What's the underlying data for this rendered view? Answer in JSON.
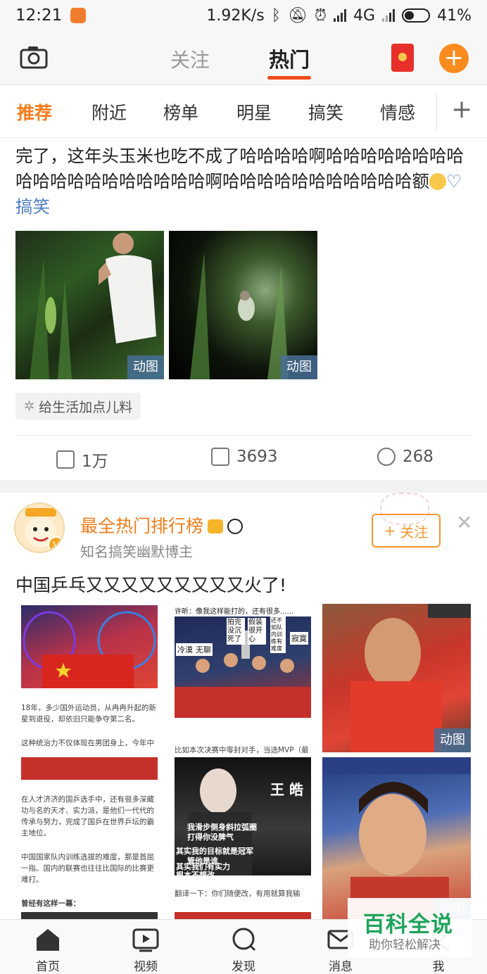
{
  "status_bar": {
    "time": "12:21",
    "speed": "1.92K/s",
    "net": "4G",
    "battery": "41%"
  },
  "header": {
    "tab_follow": "关注",
    "tab_hot": "热门"
  },
  "channels": [
    "推荐",
    "附近",
    "榜单",
    "明星",
    "搞笑",
    "情感"
  ],
  "post1": {
    "text": "完了，这年头玉米也吃不成了哈哈哈哈啊哈哈哈哈哈哈哈哈哈哈哈哈哈哈哈哈哈哈哈啊哈哈哈哈哈哈哈哈哈哈哈额",
    "topic": "搞笑",
    "gif_label": "动图",
    "chip": "给生活加点儿料",
    "repost": "1万",
    "comments": "3693",
    "likes": "268"
  },
  "post2": {
    "author": "最全热门排行榜",
    "author_desc": "知名搞笑幽默博主",
    "follow": "关注",
    "text": "中国乒乓又又又又又又又又又火了!",
    "gif_label": "动图",
    "img1_para1": "18年，多少国外运动员，从冉冉升起的新星到退役，却依旧只能争夺第二名。",
    "img1_para2": "这种统治力不仅体现在男团身上，今年中",
    "img1_para3": "在人才济济的国乒选手中，还有很多深藏功与名的天才、实力派，是他们一代代的传承与努力，完成了国乒在世界乒坛的霸主地位。",
    "img1_para4": "中国国家队内训练选拔的难度，那是首屈一指。国内的联赛也往往比国际的比赛更难打。",
    "img1_para5": "曾经有这样一幕：",
    "img2_caption": "许昕：像我这样能打的，还有很多......",
    "img2_bubbles": [
      "冷漠",
      "无聊",
      "拍完没沉死了",
      "假装很开心",
      "还不如队内训练有难度",
      "寂寞"
    ],
    "img2_para": "比如本次决赛中零封对手，当选MVP（最",
    "img2_name": "王 皓",
    "img2_subs": [
      "我滑步侧身斜拉弧圈",
      "打得你没脾气",
      "其实我的目标就是冠军",
      "管他是谁",
      "其实我们有实力",
      "根本不想改"
    ],
    "img2_para2": "翻译一下：你们随便改，有用就算我输"
  },
  "bottom_nav": [
    "首页",
    "视频",
    "发现",
    "消息",
    "我"
  ],
  "watermark": {
    "main": "百科全说",
    "sub": "助你轻松解决"
  }
}
